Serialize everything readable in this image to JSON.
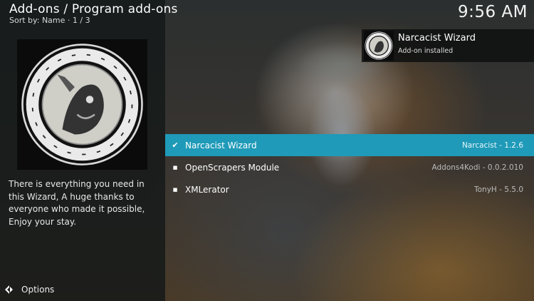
{
  "header": {
    "title": "Add-ons / Program add-ons",
    "sort_info": "Sort by: Name  ·  1 / 3",
    "clock": "9:56 AM"
  },
  "details": {
    "thumbnail_icon": "narcacist-logo",
    "description": "There is everything you need in this Wizard, A huge thanks to everyone who made it possible, Enjoy your stay."
  },
  "footer": {
    "options_label": "Options",
    "options_icon": "options-icon"
  },
  "addons": [
    {
      "name": "Narcacist Wizard",
      "meta": "Narcacist - 1.2.6",
      "marker": "✔",
      "selected": true
    },
    {
      "name": "OpenScrapers Module",
      "meta": "Addons4Kodi - 0.0.2.010",
      "marker": "■",
      "selected": false
    },
    {
      "name": "XMLerator",
      "meta": "TonyH - 5.5.0",
      "marker": "■",
      "selected": false
    }
  ],
  "notification": {
    "title": "Narcacist Wizard",
    "subtitle": "Add-on installed",
    "icon": "narcacist-logo"
  },
  "colors": {
    "highlight": "#1f9ab8"
  }
}
